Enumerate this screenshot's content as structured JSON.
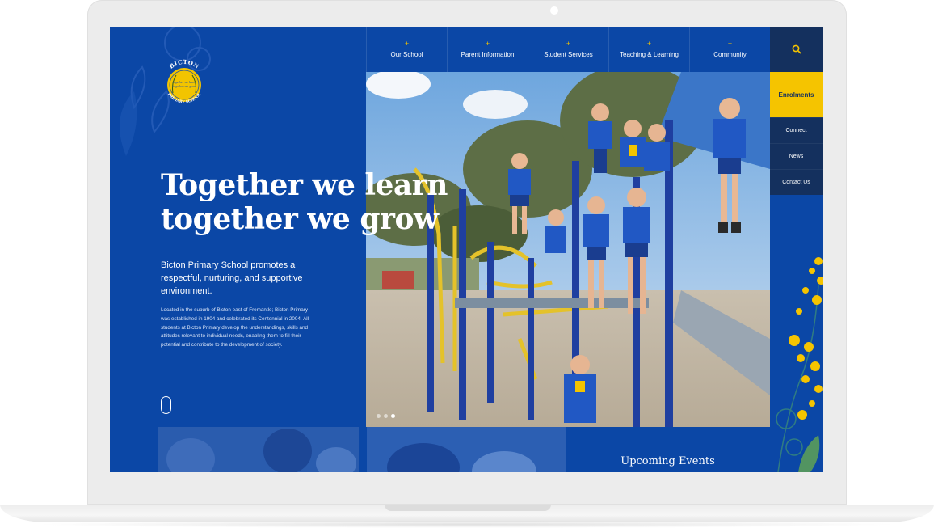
{
  "school": {
    "name": "Bicton Primary School",
    "logo_text_top": "BICTON",
    "logo_text_bottom": "PRIMARY SCHOOL",
    "logo_motto": "Together we learn together we grow"
  },
  "nav": {
    "items": [
      {
        "label": "Our School"
      },
      {
        "label": "Parent Information"
      },
      {
        "label": "Student Services"
      },
      {
        "label": "Teaching & Learning"
      },
      {
        "label": "Community"
      }
    ],
    "plus_symbol": "+"
  },
  "side_menu": {
    "primary": "Enrolments",
    "links": [
      "Connect",
      "News",
      "Contact Us"
    ]
  },
  "hero": {
    "headline_line1": "Together we learn",
    "headline_line2": "together we grow",
    "subheading": "Bicton Primary School promotes a respectful, nurturing, and supportive environment.",
    "description": "Located in the suburb of Bicton east of Fremantle; Bicton Primary was established in 1904 and celebrated its Centennial in 2004. All students at Bicton Primary develop the understandings, skills and attitudes relevant to individual needs, enabling them to fill their potential and contribute to the development of society.",
    "slide_count": 3,
    "active_slide": 3
  },
  "events": {
    "title": "Upcoming Events"
  },
  "colors": {
    "brand_blue": "#0b47a6",
    "navy": "#14305e",
    "accent_yellow": "#f5c400"
  },
  "icons": {
    "search": "search-icon",
    "scroll": "scroll-indicator-icon"
  }
}
